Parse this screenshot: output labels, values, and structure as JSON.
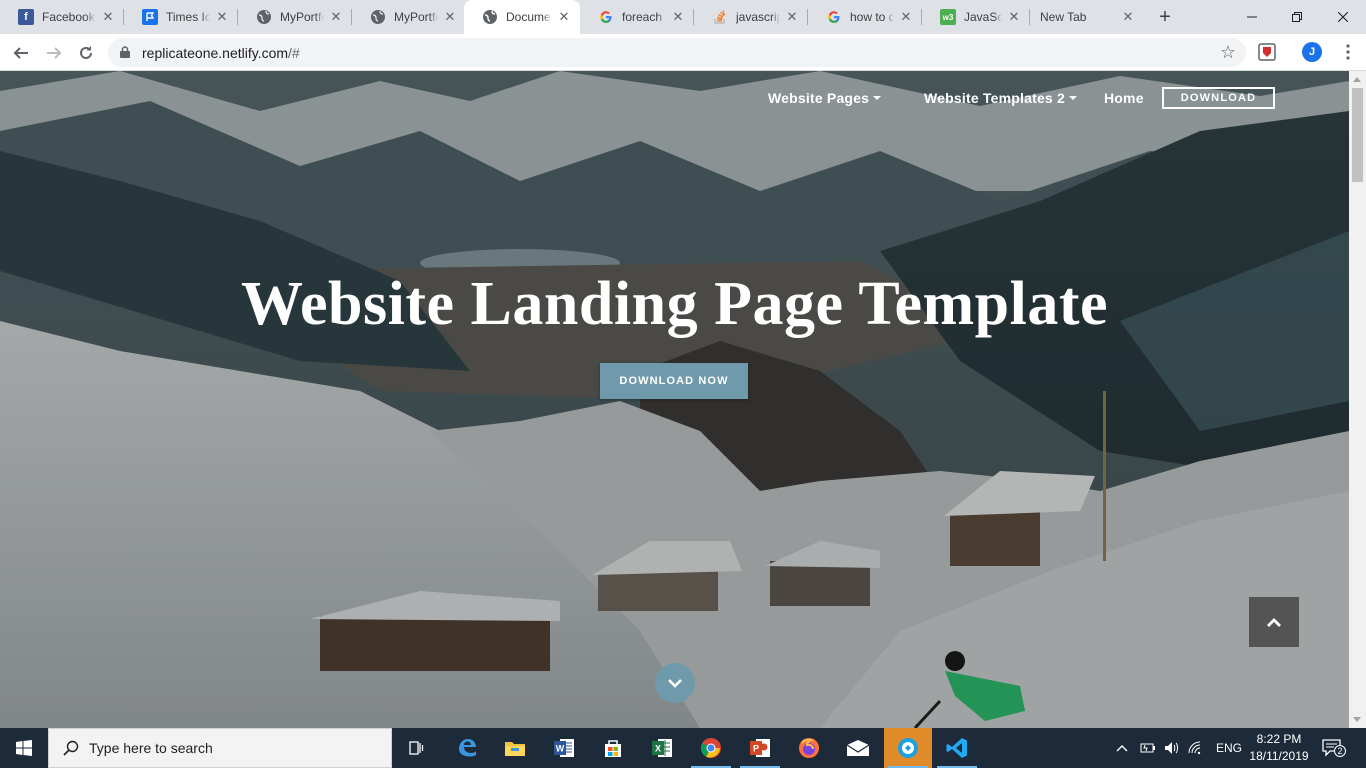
{
  "browser": {
    "tabs": [
      {
        "title": "Facebook",
        "icon": "facebook-icon",
        "color": "#3b5998",
        "active": false
      },
      {
        "title": "Times Icons",
        "icon": "flag-icon",
        "color": "#1a73e8",
        "active": false
      },
      {
        "title": "MyPortfolio",
        "icon": "globe-icon",
        "color": "#5f6368",
        "active": false
      },
      {
        "title": "MyPortfolio",
        "icon": "globe-icon",
        "color": "#5f6368",
        "active": false
      },
      {
        "title": "Document",
        "icon": "globe-icon",
        "color": "#5f6368",
        "active": true
      },
      {
        "title": "foreach a",
        "icon": "google-icon",
        "color": "#4285f4",
        "active": false
      },
      {
        "title": "javascript",
        "icon": "stackoverflow-icon",
        "color": "#f48024",
        "active": false
      },
      {
        "title": "how to d",
        "icon": "google-icon",
        "color": "#4285f4",
        "active": false
      },
      {
        "title": "JavaScript",
        "icon": "w3schools-icon",
        "color": "#4caf50",
        "active": false
      },
      {
        "title": "New Tab",
        "icon": "",
        "color": "",
        "active": false
      }
    ],
    "new_tab_label": "+",
    "url": {
      "host": "replicateone.netlify.com",
      "path": "/#"
    },
    "profile_initial": "J"
  },
  "site": {
    "nav": {
      "pages_label": "Website Pages",
      "templates_label": "Website Templates 2",
      "home_label": "Home",
      "download_label": "DOWNLOAD"
    },
    "headline": "Website Landing Page Template",
    "cta_label": "DOWNLOAD NOW",
    "accent_color": "#6f9aab"
  },
  "taskbar": {
    "search_placeholder": "Type here to search",
    "language": "ENG",
    "time": "8:22 PM",
    "date": "18/11/2019",
    "notification_count": "2",
    "apps": [
      "task-view-icon",
      "edge-icon",
      "file-explorer-icon",
      "word-icon",
      "store-icon",
      "excel-icon",
      "chrome-icon",
      "powerpoint-icon",
      "firefox-icon",
      "mail-icon",
      "app-icon",
      "vscode-icon"
    ]
  }
}
